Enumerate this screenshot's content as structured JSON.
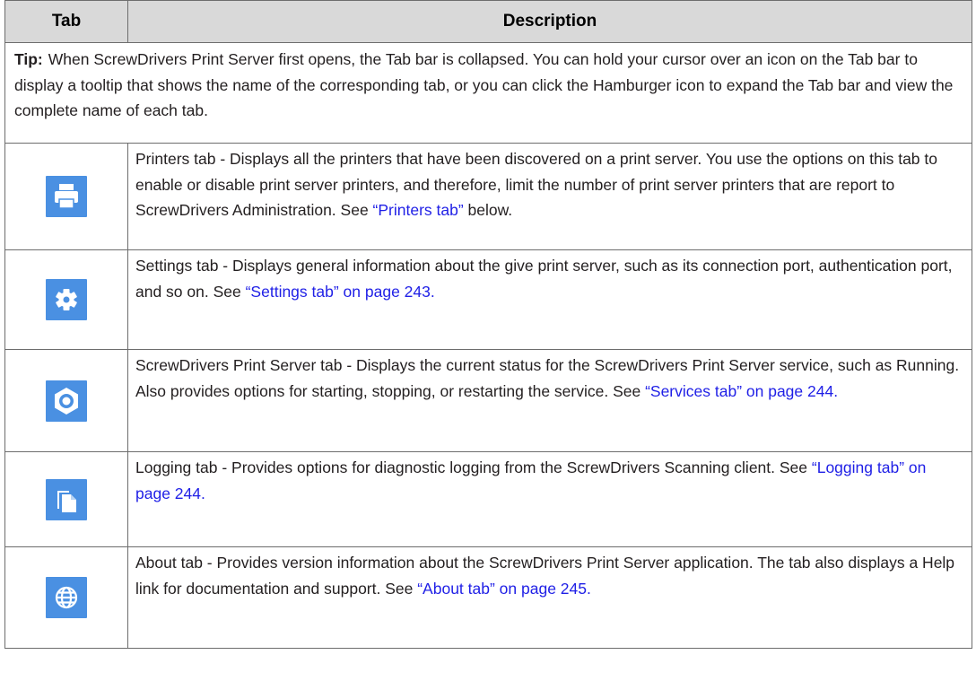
{
  "header": {
    "col_tab": "Tab",
    "col_description": "Description"
  },
  "tip": {
    "label": "Tip:",
    "text": "When ScrewDrivers Print Server first opens, the Tab bar is collapsed. You can hold your cursor over an icon on the Tab bar to display a tooltip that shows the name of the corresponding tab, or you can click the Hamburger icon to expand the Tab bar and view the complete name of each tab."
  },
  "rows": [
    {
      "icon": "printer-icon",
      "text": "Printers tab - Displays all the printers that have been discovered on a print server. You use the options on this tab to enable or disable print server printers, and therefore, limit the number of print server printers that are report to ScrewDrivers Administration. See ",
      "link": "“Printers tab”",
      "after": " below."
    },
    {
      "icon": "gear-icon",
      "text": "Settings tab - Displays general information about the give print server, such as its connection port, authentication port, and so on. See ",
      "link": "“Settings tab” on page 243.",
      "after": ""
    },
    {
      "icon": "service-icon",
      "text": "ScrewDrivers Print Server tab - Displays the current status for the ScrewDrivers Print Server service, such as Running. Also provides options for starting, stopping, or restarting the service. See ",
      "link": "“Services tab” on page 244.",
      "after": ""
    },
    {
      "icon": "copy-icon",
      "text": "Logging tab - Provides options for diagnostic logging from the ScrewDrivers Scanning client. See ",
      "link": "“Logging tab” on page 244.",
      "after": ""
    },
    {
      "icon": "globe-icon",
      "text": "About tab - Provides version information about the ScrewDrivers Print Server application. The tab also displays a Help link for documentation and support. See ",
      "link": "“About tab” on page 245.",
      "after": ""
    }
  ],
  "colors": {
    "icon_bg": "#4a90e2",
    "link": "#1f1fe6",
    "header_bg": "#d9d9d9"
  }
}
